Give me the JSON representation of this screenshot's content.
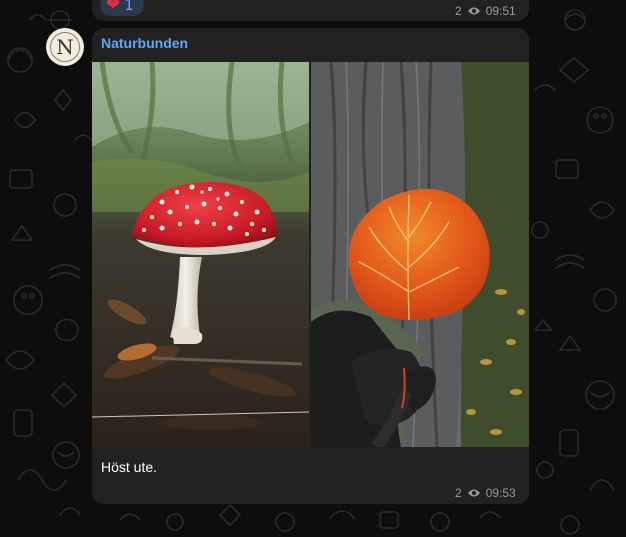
{
  "previous_message": {
    "reaction_emoji": "❤",
    "reaction_count": "1",
    "views": "2",
    "time": "09:51"
  },
  "message": {
    "avatar_letter": "N",
    "sender": "Naturbunden",
    "caption": "Höst ute.",
    "views": "2",
    "time": "09:53",
    "photos": [
      {
        "subject": "fly agaric mushroom on forest floor"
      },
      {
        "subject": "orange aspen leaf held in gloved hand by tree trunk"
      }
    ]
  },
  "colors": {
    "bubble": "#212121",
    "sender": "#5aa8ff",
    "reaction_bg": "#2b3a4c",
    "heart": "#e0303f",
    "background": "#0d0d0e"
  }
}
